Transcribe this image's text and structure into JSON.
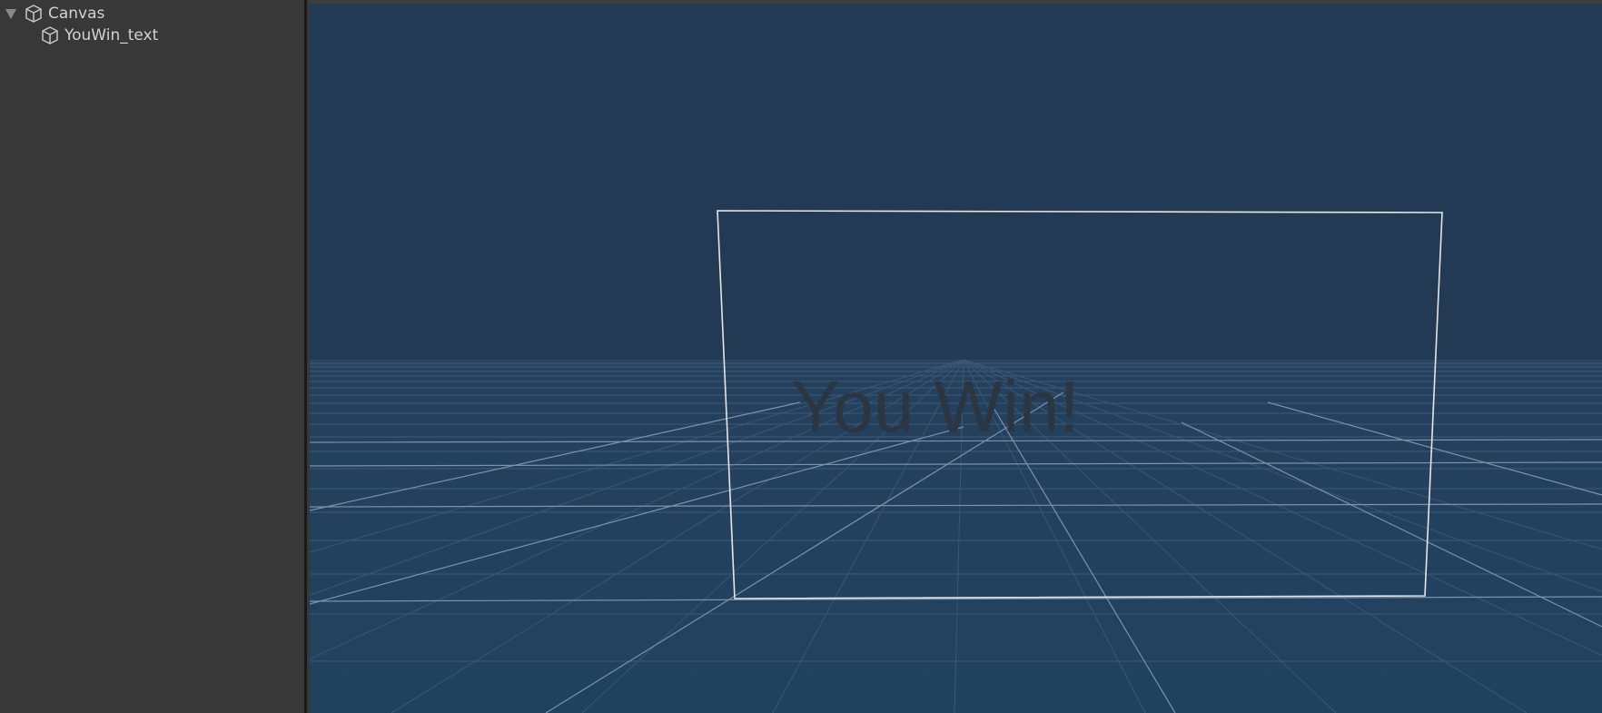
{
  "hierarchy": {
    "items": [
      {
        "label": "Canvas",
        "icon": "gameobject-cube-icon",
        "expanded": true,
        "depth": 0
      },
      {
        "label": "YouWin_text",
        "icon": "gameobject-cube-icon",
        "depth": 1
      }
    ]
  },
  "scene": {
    "text": "You Win!",
    "colors": {
      "sky": "#223a53",
      "ground": "#22425f",
      "text": "#2a3540",
      "canvas_outline": "#e6e6e6",
      "grid": "#5d7894"
    }
  }
}
